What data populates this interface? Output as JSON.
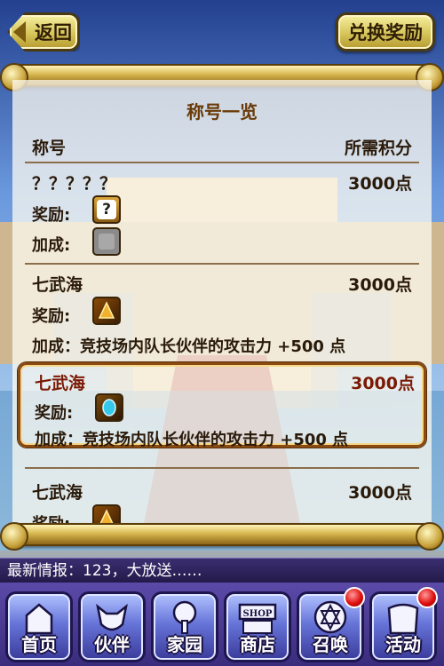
{
  "header": {
    "back_label": "返回",
    "redeem_label": "兑换奖励"
  },
  "panel": {
    "title": "称号一览",
    "col_name": "称号",
    "col_points": "所需积分",
    "entries": [
      {
        "name": "？？？？？",
        "points": "3000点",
        "reward_label": "奖励:",
        "reward_icon": "question-mark-icon",
        "bonus_label": "加成:",
        "bonus_icon": "locked-icon",
        "bonus_text": ""
      },
      {
        "name": "七武海",
        "points": "3000点",
        "reward_label": "奖励:",
        "reward_icon": "crest-icon",
        "bonus_label": "加成:",
        "bonus_text": "加成：竞技场内队长伙伴的攻击力 +500 点"
      },
      {
        "name": "七武海",
        "points": "3000点",
        "reward_label": "奖励:",
        "reward_icon": "gem-icon",
        "bonus_label": "加成:",
        "bonus_text": "加成：竞技场内队长伙伴的攻击力 +500 点",
        "selected": true
      },
      {
        "name": "七武海",
        "points": "3000点",
        "reward_label": "奖励:",
        "reward_icon": "crest-icon"
      }
    ]
  },
  "news": {
    "text": "最新情报：123，大放送……"
  },
  "nav": {
    "items": [
      {
        "label": "首页",
        "icon": "home-icon"
      },
      {
        "label": "伙伴",
        "icon": "partner-icon"
      },
      {
        "label": "家园",
        "icon": "tree-icon"
      },
      {
        "label": "商店",
        "icon": "shop-icon",
        "sign": "SHOP"
      },
      {
        "label": "召唤",
        "icon": "summon-icon",
        "badge": true
      },
      {
        "label": "活动",
        "icon": "event-icon",
        "badge": true
      }
    ]
  },
  "colors": {
    "title_brown": "#6a3a08",
    "selected_red": "#7a1a06",
    "nav_purple": "#3a2c7c"
  }
}
